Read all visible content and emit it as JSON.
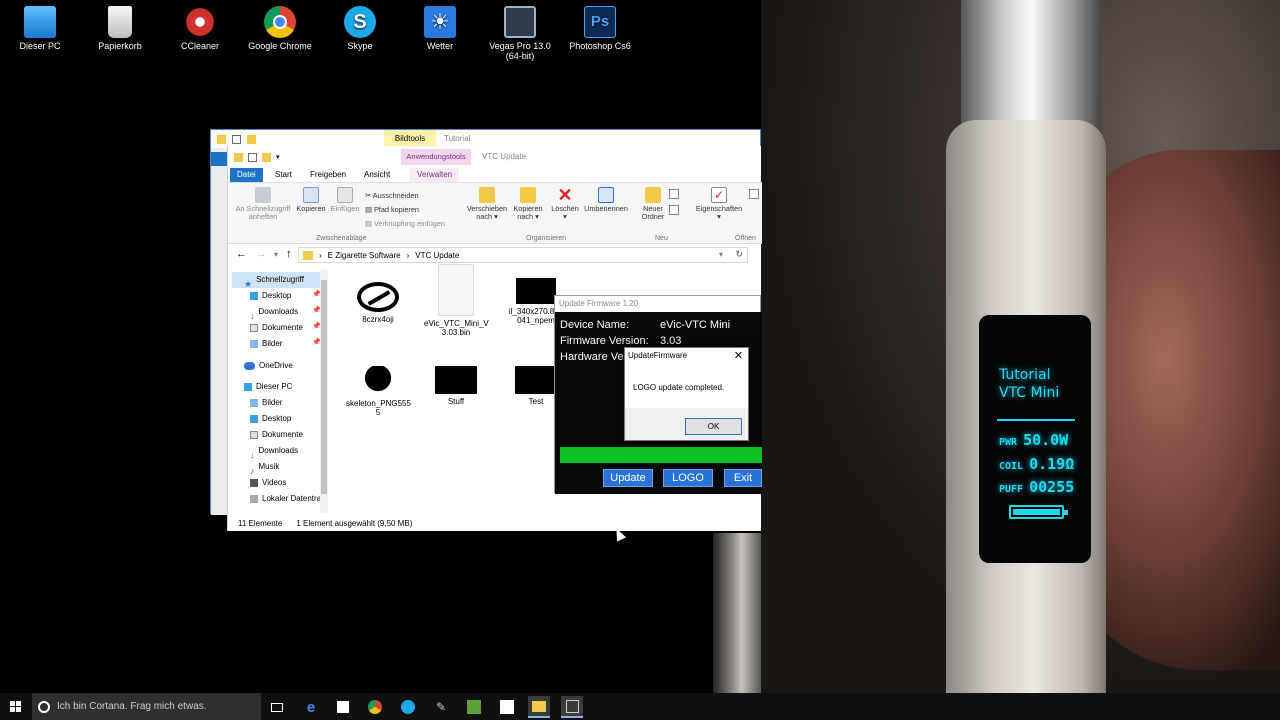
{
  "desktop": {
    "icons": [
      {
        "label_l1": "Dieser PC",
        "label_l2": "",
        "icon": "computer-icon",
        "color": "#39a0ea"
      },
      {
        "label_l1": "Papierkorb",
        "label_l2": "",
        "icon": "recycle-bin-icon",
        "color": "#e8e8e8"
      },
      {
        "label_l1": "CCleaner",
        "label_l2": "",
        "icon": "ccleaner-icon",
        "color": "#d0312d"
      },
      {
        "label_l1": "Google Chrome",
        "label_l2": "",
        "icon": "chrome-icon",
        "color": "#3c9a42"
      },
      {
        "label_l1": "Skype",
        "label_l2": "",
        "icon": "skype-icon",
        "color": "#1ba9e8"
      },
      {
        "label_l1": "Wetter",
        "label_l2": "",
        "icon": "weather-icon",
        "color": "#2a7be0"
      },
      {
        "label_l1": "Vegas Pro 13.0",
        "label_l2": "(64-bit)",
        "icon": "vegas-icon",
        "color": "#2f3a4a"
      },
      {
        "label_l1": "Photoshop Cs6",
        "label_l2": "",
        "icon": "photoshop-icon",
        "color": "#0f2a52"
      }
    ]
  },
  "back_window": {
    "context_tab": "Bildtools",
    "context_title": "Tutorial"
  },
  "explorer": {
    "context_tab": "Anwendungstools",
    "title": "VTC Update",
    "tabs": {
      "datei": "Datei",
      "start": "Start",
      "freigeben": "Freigeben",
      "ansicht": "Ansicht",
      "verwalten": "Verwalten"
    },
    "ribbon": {
      "pin_l1": "An Schnellzugriff",
      "pin_l2": "anheften",
      "copy": "Kopieren",
      "paste": "Einfügen",
      "cut": "Ausschneiden",
      "copy_path": "Pfad kopieren",
      "paste_link": "Verknüpfung einfügen",
      "move_l1": "Verschieben",
      "move_l2": "nach ▾",
      "copyto_l1": "Kopieren",
      "copyto_l2": "nach ▾",
      "delete_l1": "Löschen",
      "delete_l2": "▾",
      "rename": "Umbenennen",
      "newfolder_l1": "Neuer",
      "newfolder_l2": "Ordner",
      "props_l1": "Eigenschaften",
      "props_l2": "▾",
      "group_clipboard": "Zwischenablage",
      "group_organize": "Organisieren",
      "group_new": "Neu",
      "group_open": "Öffnen"
    },
    "address": {
      "part1": "E Zigarette Software",
      "part2": "VTC Update"
    },
    "nav": {
      "quick": "Schnellzugriff",
      "desktop": "Desktop",
      "downloads": "Downloads",
      "dokumente": "Dokumente",
      "bilder": "Bilder",
      "onedrive": "OneDrive",
      "pc": "Dieser PC",
      "pc_bilder": "Bilder",
      "pc_desktop": "Desktop",
      "pc_dokumente": "Dokumente",
      "pc_downloads": "Downloads",
      "musik": "Musik",
      "videos": "Videos",
      "lokaler": "Lokaler Datentra"
    },
    "files": [
      {
        "l1": "8czrx4oji",
        "l2": ""
      },
      {
        "l1": "eVic_VTC_Mini_V",
        "l2": "3.03.bin"
      },
      {
        "l1": "il_340x270.843",
        "l2": "041_npem"
      },
      {
        "l1": "skeleton_PNG555",
        "l2": "5"
      },
      {
        "l1": "Stuff",
        "l2": ""
      },
      {
        "l1": "Test",
        "l2": ""
      }
    ],
    "status": {
      "count": "11 Elemente",
      "selected": "1 Element ausgewählt (9,50 MB)"
    }
  },
  "update_fw": {
    "title": "Update Firmware 1.20",
    "device_label": "Device Name:",
    "device_value": "eVic-VTC Mini",
    "fw_label": "Firmware Version:",
    "fw_value": "3.03",
    "hw_label": "Hardware Ve",
    "progress": 1.0,
    "buttons": {
      "update": "Update",
      "logo": "LOGO",
      "exit": "Exit"
    }
  },
  "dialog": {
    "title": "UpdateFirmware",
    "message": "LOGO update completed.",
    "ok": "OK"
  },
  "device_screen": {
    "line1": "Tutorial",
    "line2": "VTC Mini",
    "pwr_label": "PWR",
    "pwr_value": "50.0W",
    "coil_label": "COIL",
    "coil_value": "0.19Ω",
    "puff_label": "PUFF",
    "puff_value": "00255",
    "battery": 1.0
  },
  "taskbar": {
    "search_placeholder": "Ich bin Cortana. Frag mich etwas."
  },
  "colors": {
    "accent": "#1e73c9",
    "progress": "#11c121",
    "device_text": "#1fd8f0"
  }
}
